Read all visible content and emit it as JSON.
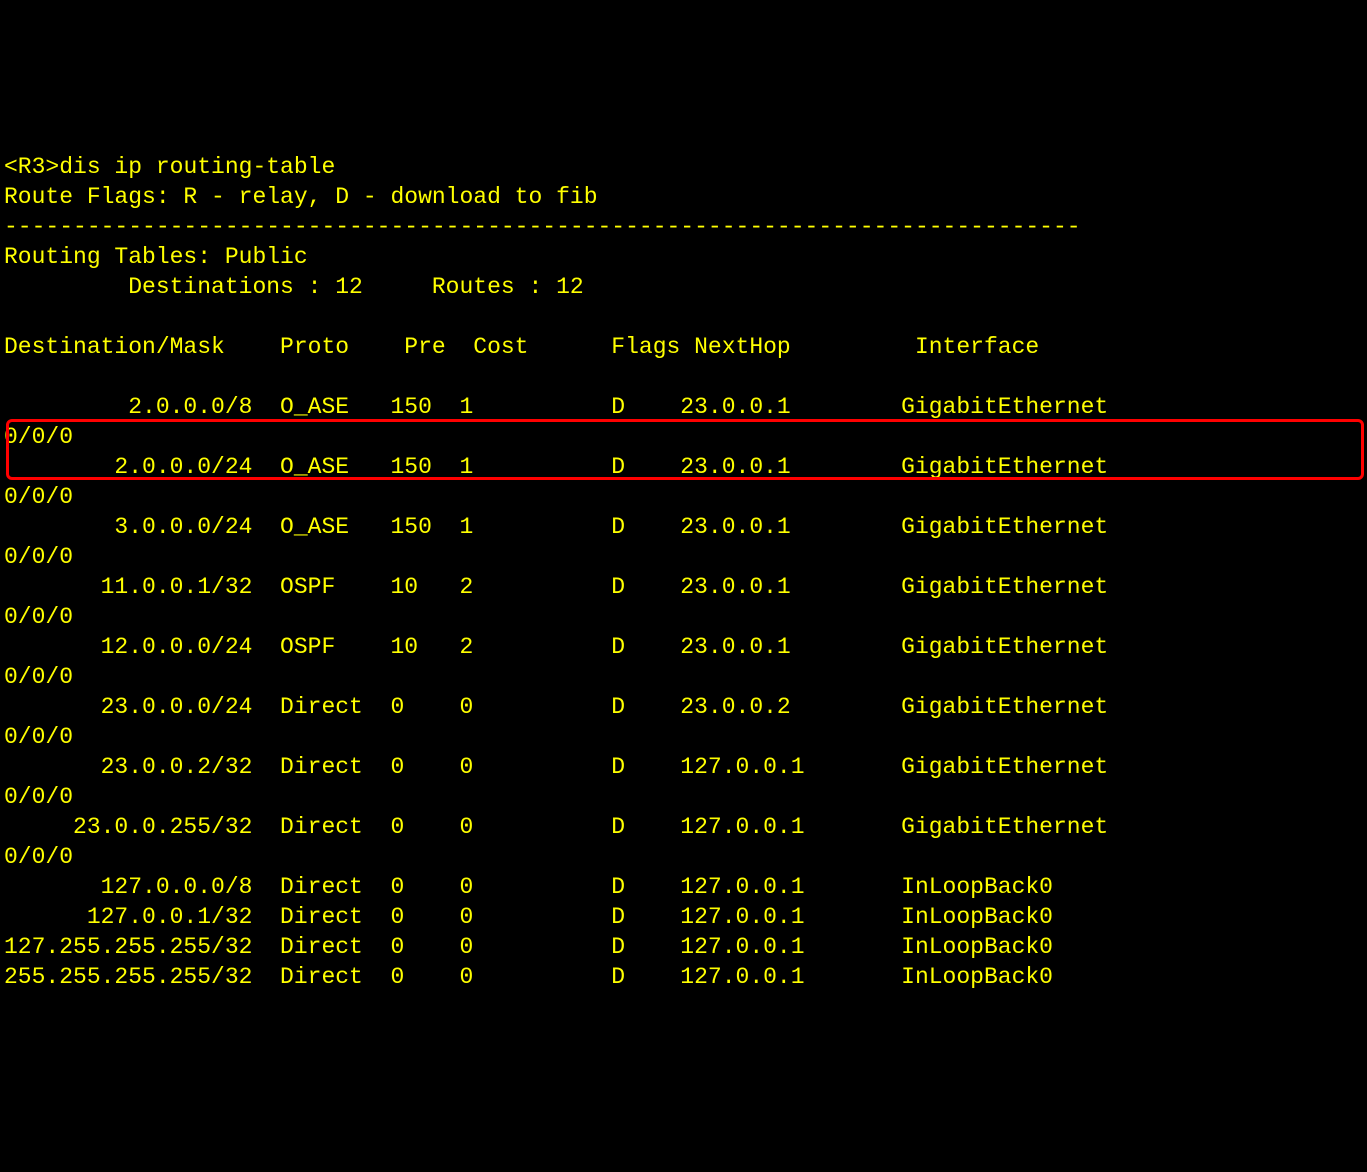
{
  "prompt_prefix": "<R3>",
  "command": "dis ip routing-table",
  "route_flags_line": "Route Flags: R - relay, D - download to fib",
  "separator": "------------------------------------------------------------------------------",
  "table_header_line": "Routing Tables: Public",
  "destinations_label": "Destinations : 12",
  "routes_label": "Routes : 12",
  "columns": {
    "dest": "Destination/Mask",
    "proto": "Proto",
    "pre": "Pre",
    "cost": "Cost",
    "flags": "Flags",
    "nexthop": "NextHop",
    "interface": "Interface"
  },
  "routes": [
    {
      "dest": "2.0.0.0/8",
      "proto": "O_ASE",
      "pre": "150",
      "cost": "1",
      "flags": "D",
      "nexthop": "23.0.0.1",
      "iface": "GigabitEthernet",
      "wrap": "0/0/0"
    },
    {
      "dest": "2.0.0.0/24",
      "proto": "O_ASE",
      "pre": "150",
      "cost": "1",
      "flags": "D",
      "nexthop": "23.0.0.1",
      "iface": "GigabitEthernet",
      "wrap": "0/0/0"
    },
    {
      "dest": "3.0.0.0/24",
      "proto": "O_ASE",
      "pre": "150",
      "cost": "1",
      "flags": "D",
      "nexthop": "23.0.0.1",
      "iface": "GigabitEthernet",
      "wrap": "0/0/0"
    },
    {
      "dest": "11.0.0.1/32",
      "proto": "OSPF",
      "pre": "10",
      "cost": "2",
      "flags": "D",
      "nexthop": "23.0.0.1",
      "iface": "GigabitEthernet",
      "wrap": "0/0/0"
    },
    {
      "dest": "12.0.0.0/24",
      "proto": "OSPF",
      "pre": "10",
      "cost": "2",
      "flags": "D",
      "nexthop": "23.0.0.1",
      "iface": "GigabitEthernet",
      "wrap": "0/0/0"
    },
    {
      "dest": "23.0.0.0/24",
      "proto": "Direct",
      "pre": "0",
      "cost": "0",
      "flags": "D",
      "nexthop": "23.0.0.2",
      "iface": "GigabitEthernet",
      "wrap": "0/0/0"
    },
    {
      "dest": "23.0.0.2/32",
      "proto": "Direct",
      "pre": "0",
      "cost": "0",
      "flags": "D",
      "nexthop": "127.0.0.1",
      "iface": "GigabitEthernet",
      "wrap": "0/0/0"
    },
    {
      "dest": "23.0.0.255/32",
      "proto": "Direct",
      "pre": "0",
      "cost": "0",
      "flags": "D",
      "nexthop": "127.0.0.1",
      "iface": "GigabitEthernet",
      "wrap": "0/0/0"
    },
    {
      "dest": "127.0.0.0/8",
      "proto": "Direct",
      "pre": "0",
      "cost": "0",
      "flags": "D",
      "nexthop": "127.0.0.1",
      "iface": "InLoopBack0",
      "wrap": ""
    },
    {
      "dest": "127.0.0.1/32",
      "proto": "Direct",
      "pre": "0",
      "cost": "0",
      "flags": "D",
      "nexthop": "127.0.0.1",
      "iface": "InLoopBack0",
      "wrap": ""
    },
    {
      "dest": "127.255.255.255/32",
      "proto": "Direct",
      "pre": "0",
      "cost": "0",
      "flags": "D",
      "nexthop": "127.0.0.1",
      "iface": "InLoopBack0",
      "wrap": ""
    },
    {
      "dest": "255.255.255.255/32",
      "proto": "Direct",
      "pre": "0",
      "cost": "0",
      "flags": "D",
      "nexthop": "127.0.0.1",
      "iface": "InLoopBack0",
      "wrap": ""
    }
  ]
}
